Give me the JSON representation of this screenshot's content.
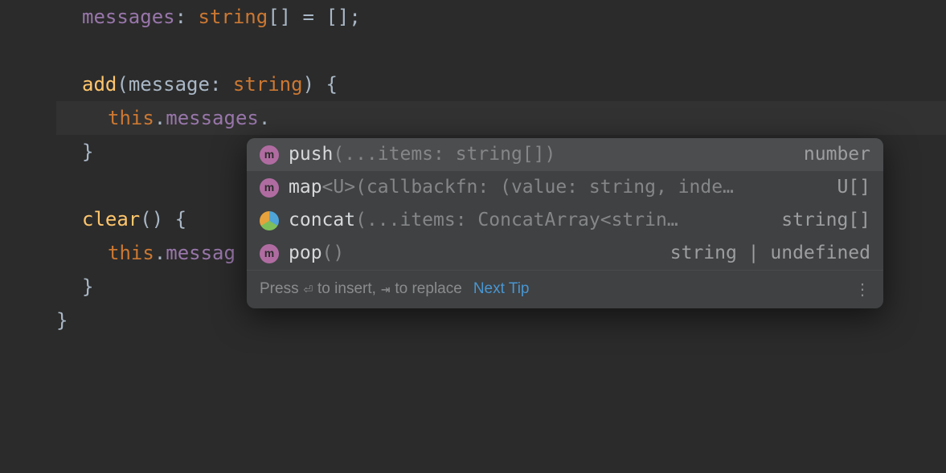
{
  "code": {
    "l1_field": "messages",
    "l1_punct1": ": ",
    "l1_type": "string",
    "l1_punct2": "[] = [];",
    "l3_method": "add",
    "l3_punct1": "(",
    "l3_param": "message",
    "l3_punct2": ": ",
    "l3_type": "string",
    "l3_punct3": ") {",
    "l4_this": "this",
    "l4_punct1": ".",
    "l4_field": "messages",
    "l4_punct2": ".",
    "l5_close": "}",
    "l7_method": "clear",
    "l7_punct": "() {",
    "l8_this": "this",
    "l8_punct1": ".",
    "l8_field": "messag",
    "l9_close": "}",
    "l10_close": "}"
  },
  "popup": {
    "rows": [
      {
        "icon": "m",
        "name": "push",
        "params": "(...items: string[])",
        "ret": "number"
      },
      {
        "icon": "m",
        "name": "map",
        "params": "<U>(callbackfn: (value: string, inde…",
        "ret": "U[]"
      },
      {
        "icon": "multi",
        "name": "concat",
        "params": "(...items: ConcatArray<strin…",
        "ret": "string[]"
      },
      {
        "icon": "m",
        "name": "pop",
        "params": "()",
        "ret": "string | undefined"
      }
    ],
    "footer": {
      "hint_pre": "Press ",
      "kbd1": "⏎",
      "hint_mid": " to insert, ",
      "kbd2": "⇥",
      "hint_post": " to replace",
      "next_tip": "Next Tip",
      "more": "⋮"
    }
  }
}
